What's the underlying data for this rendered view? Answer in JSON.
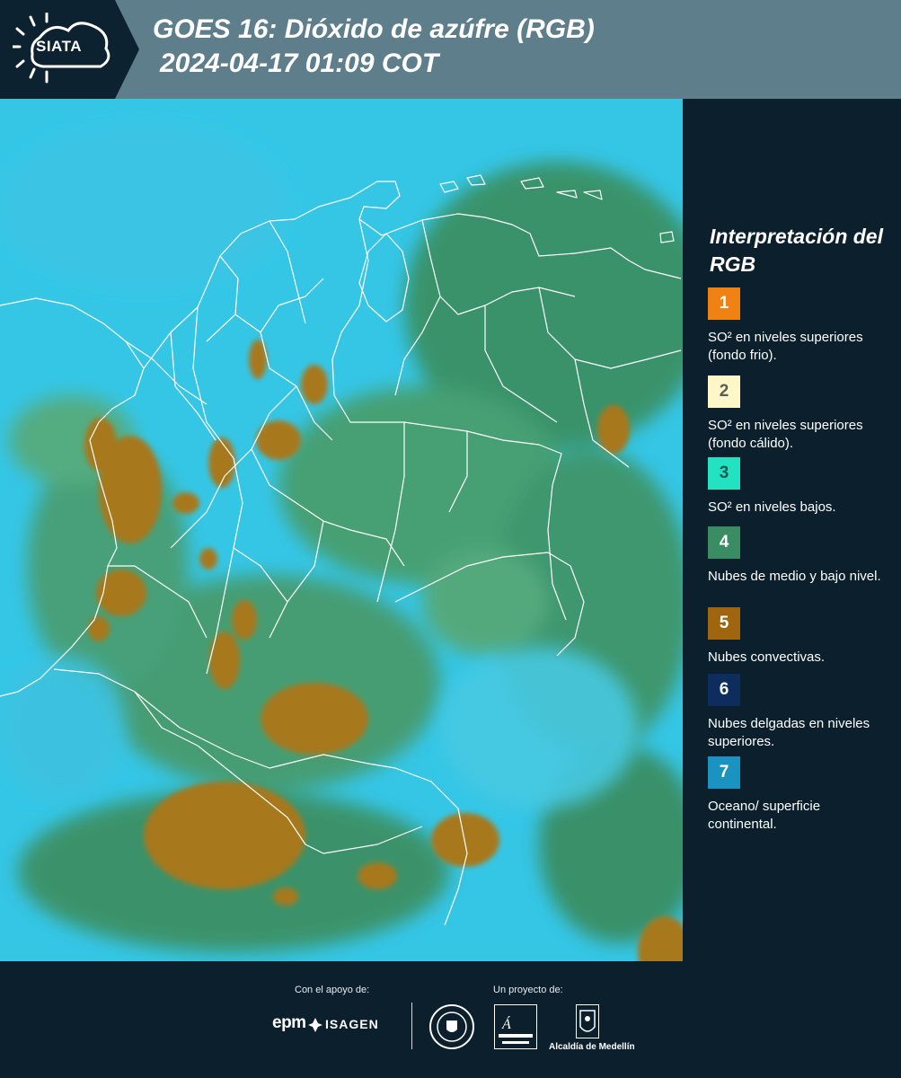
{
  "header": {
    "logo_text": "SIATA",
    "title_line1": "GOES 16: Dióxido de azúfre (RGB)",
    "title_line2": "2024-04-17 01:09 COT"
  },
  "legend": {
    "title": "Interpretación del RGB",
    "items": [
      {
        "number": "1",
        "color": "#f08213",
        "text_color": "#ffffff",
        "label": "SO² en niveles superiores (fondo frio)."
      },
      {
        "number": "2",
        "color": "#fff7c8",
        "text_color": "#5a5a5a",
        "label": "SO² en niveles superiores (fondo cálido)."
      },
      {
        "number": "3",
        "color": "#22e2c2",
        "text_color": "#1a5a55",
        "label": "SO² en niveles bajos."
      },
      {
        "number": "4",
        "color": "#3a8c63",
        "text_color": "#ffffff",
        "label": "Nubes de medio y bajo nivel."
      },
      {
        "number": "5",
        "color": "#a0650f",
        "text_color": "#ffffff",
        "label": "Nubes convectivas."
      },
      {
        "number": "6",
        "color": "#0d2d5e",
        "text_color": "#ffffff",
        "label": "Nubes delgadas en niveles superiores."
      },
      {
        "number": "7",
        "color": "#1a93c0",
        "text_color": "#ffffff",
        "label": "Oceano/ superficie continental."
      }
    ]
  },
  "footer": {
    "support_label": "Con el apoyo de:",
    "project_label": "Un proyecto de:",
    "epm": "epm",
    "isagen": "ISAGEN",
    "area_logo": "Área Metropolitana Valle de Aburrá",
    "alcaldia": "Alcaldía de Medellín"
  },
  "map": {
    "ocean_color": "#35c6e6",
    "cloud_green": "#3f8a5a",
    "convective_color": "#a7781f",
    "border_color": "#ffffff"
  }
}
